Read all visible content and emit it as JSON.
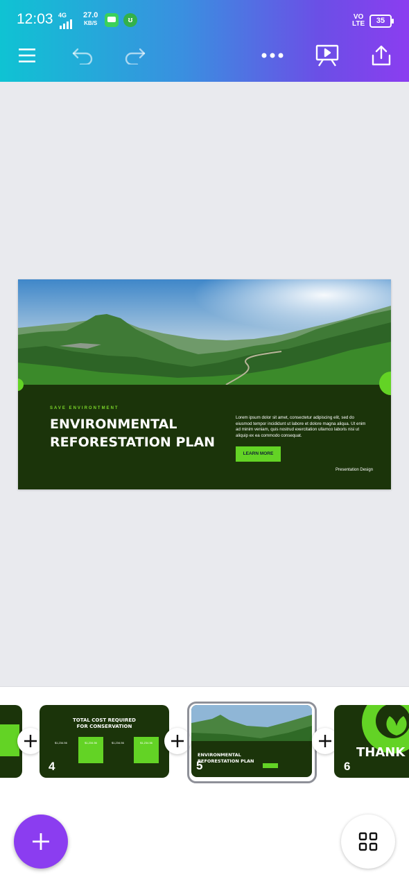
{
  "status_bar": {
    "time": "12:03",
    "network": "4G",
    "speed_value": "27.0",
    "speed_unit": "KB/S",
    "volte_line1": "VO",
    "volte_line2": "LTE",
    "battery": "35"
  },
  "toolbar": {
    "icons": [
      "menu-icon",
      "undo-icon",
      "redo-icon",
      "more-icon",
      "present-icon",
      "share-icon"
    ]
  },
  "slide": {
    "kicker": "SAVE ENVIRONTMENT",
    "title_line1": "ENVIRONMENTAL",
    "title_line2": "REFORESTATION PLAN",
    "body": "Lorem ipsum dolor sit amet, consectetur adipiscing elit, sed do eiusmod tempor incididunt ut labore et dolore magna aliqua. Ut enim ad minim veniam, quis nostrud exercitation ullamco laboris nisi ut aliquip ex ea commodo consequat.",
    "button": "LEARN MORE",
    "footer": "Presentation Design",
    "accent": "#63d325",
    "bg": "#1b340a"
  },
  "thumbnails": [
    {
      "number": "4",
      "title_line1": "TOTAL COST REQUIRED",
      "title_line2": "FOR CONSERVATION",
      "prices": [
        "$1,234.56",
        "$1,234.56",
        "$1,234.56",
        "$1,234.56"
      ]
    },
    {
      "number": "5",
      "title_line1": "ENVIRONMENTAL",
      "title_line2": "REFORESTATION PLAN",
      "selected": true
    },
    {
      "number": "6",
      "title": "THANK"
    }
  ],
  "fab_icon": "plus-icon",
  "grid_icon": "grid-icon"
}
